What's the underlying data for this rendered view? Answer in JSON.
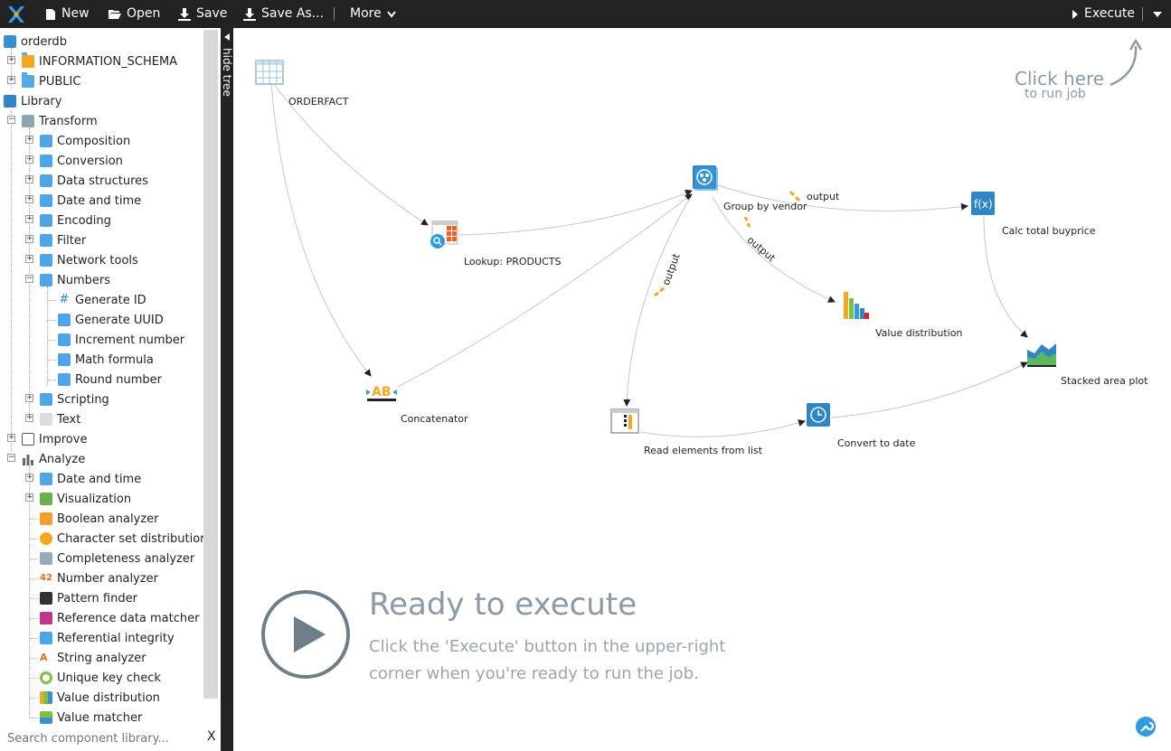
{
  "toolbar": {
    "new_label": "New",
    "open_label": "Open",
    "save_label": "Save",
    "save_as_label": "Save As...",
    "more_label": "More",
    "execute_label": "Execute"
  },
  "tree": {
    "datastore": "orderdb",
    "schemas": [
      "INFORMATION_SCHEMA",
      "PUBLIC"
    ],
    "library": "Library",
    "transform": "Transform",
    "transform_items": [
      "Composition",
      "Conversion",
      "Data structures",
      "Date and time",
      "Encoding",
      "Filter",
      "Network tools",
      "Numbers"
    ],
    "numbers_items": [
      "Generate ID",
      "Generate UUID",
      "Increment number",
      "Math formula",
      "Round number"
    ],
    "transform_items_after": [
      "Scripting",
      "Text"
    ],
    "improve": "Improve",
    "analyze": "Analyze",
    "analyze_categories": [
      "Date and time",
      "Visualization"
    ],
    "analyze_items": [
      "Boolean analyzer",
      "Character set distribution",
      "Completeness analyzer",
      "Number analyzer",
      "Pattern finder",
      "Reference data matcher",
      "Referential integrity",
      "String analyzer",
      "Unique key check",
      "Value distribution",
      "Value matcher"
    ]
  },
  "search": {
    "placeholder": "Search component library...",
    "clear_label": "X"
  },
  "hide_tree_label": "hide tree",
  "graph": {
    "components": {
      "orderfact": "ORDERFACT",
      "lookup": "Lookup: PRODUCTS",
      "concat": "Concatenator",
      "groupby": "Group by vendor",
      "calc": "Calc total buyprice",
      "valdist": "Value distribution",
      "stacked": "Stacked area plot",
      "readlist": "Read elements from list",
      "convdate": "Convert to date"
    },
    "edge_label": "output"
  },
  "hint": {
    "title": "Click here",
    "subtitle": "to run job"
  },
  "ready": {
    "title": "Ready to execute",
    "message": "Click the 'Execute' button in the upper-right corner when you're ready to run the job."
  }
}
